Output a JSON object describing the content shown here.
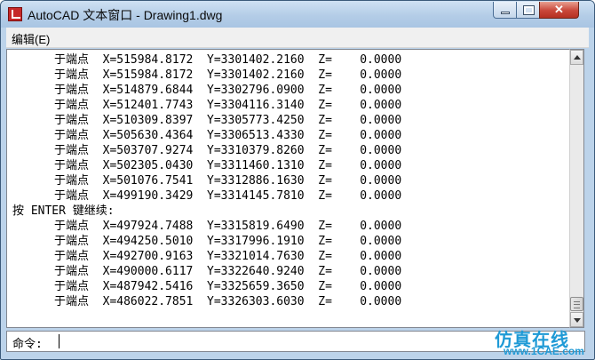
{
  "window": {
    "title": "AutoCAD 文本窗口 - Drawing1.dwg",
    "close_glyph": "✕"
  },
  "menu": {
    "items": [
      "编辑(E)"
    ]
  },
  "text": {
    "lines": [
      "      于端点  X=515984.8172  Y=3301402.2160  Z=    0.0000",
      "      于端点  X=515984.8172  Y=3301402.2160  Z=    0.0000",
      "      于端点  X=514879.6844  Y=3302796.0900  Z=    0.0000",
      "      于端点  X=512401.7743  Y=3304116.3140  Z=    0.0000",
      "      于端点  X=510309.8397  Y=3305773.4250  Z=    0.0000",
      "      于端点  X=505630.4364  Y=3306513.4330  Z=    0.0000",
      "      于端点  X=503707.9274  Y=3310379.8260  Z=    0.0000",
      "      于端点  X=502305.0430  Y=3311460.1310  Z=    0.0000",
      "      于端点  X=501076.7541  Y=3312886.1630  Z=    0.0000",
      "      于端点  X=499190.3429  Y=3314145.7810  Z=    0.0000",
      "按 ENTER 键继续:",
      "      于端点  X=497924.7488  Y=3315819.6490  Z=    0.0000",
      "      于端点  X=494250.5010  Y=3317996.1910  Z=    0.0000",
      "      于端点  X=492700.9163  Y=3321014.7630  Z=    0.0000",
      "      于端点  X=490000.6117  Y=3322640.9240  Z=    0.0000",
      "      于端点  X=487942.5416  Y=3325659.3650  Z=    0.0000",
      "      于端点  X=486022.7851  Y=3326303.6030  Z=    0.0000"
    ]
  },
  "command": {
    "prompt": "命令:",
    "value": ""
  },
  "watermark": {
    "main": "仿真在线",
    "sub": "www.1CAE.com"
  }
}
